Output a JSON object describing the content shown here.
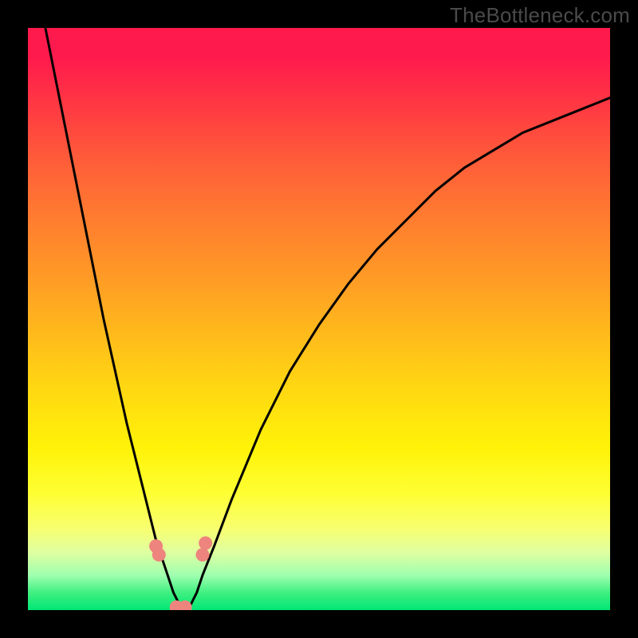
{
  "watermark": "TheBottleneck.com",
  "colors": {
    "frame": "#000000",
    "watermark": "#4a4a4a",
    "curve": "#000000",
    "markers": "#ee847e",
    "gradient_stops": [
      {
        "pos": 0,
        "color": "#ff1a4d"
      },
      {
        "pos": 5,
        "color": "#ff1a4d"
      },
      {
        "pos": 12,
        "color": "#ff3344"
      },
      {
        "pos": 22,
        "color": "#ff5a3a"
      },
      {
        "pos": 32,
        "color": "#ff7a30"
      },
      {
        "pos": 42,
        "color": "#ff9826"
      },
      {
        "pos": 52,
        "color": "#ffb81c"
      },
      {
        "pos": 62,
        "color": "#ffd812"
      },
      {
        "pos": 72,
        "color": "#fff208"
      },
      {
        "pos": 80,
        "color": "#feff33"
      },
      {
        "pos": 86,
        "color": "#f8ff70"
      },
      {
        "pos": 90,
        "color": "#e0ffa0"
      },
      {
        "pos": 94,
        "color": "#a0ffb0"
      },
      {
        "pos": 97,
        "color": "#40f080"
      },
      {
        "pos": 100,
        "color": "#00e676"
      }
    ]
  },
  "chart_data": {
    "type": "line",
    "title": "",
    "xlabel": "",
    "ylabel": "",
    "xlim": [
      0,
      100
    ],
    "ylim": [
      0,
      100
    ],
    "note": "Values are percentages; y=0 is bottom (green), y=100 is top (red). Single V-shaped curve with minimum near x≈25.",
    "series": [
      {
        "name": "bottleneck-curve",
        "x": [
          3,
          5,
          7,
          9,
          11,
          13,
          15,
          17,
          19,
          21,
          22,
          23,
          24,
          25,
          26,
          27,
          28,
          29,
          30,
          32,
          35,
          40,
          45,
          50,
          55,
          60,
          65,
          70,
          75,
          80,
          85,
          90,
          95,
          100
        ],
        "y": [
          100,
          90,
          80,
          70,
          60,
          50,
          41,
          32,
          24,
          16,
          12,
          9,
          6,
          3,
          1,
          0,
          1,
          3,
          6,
          11,
          19,
          31,
          41,
          49,
          56,
          62,
          67,
          72,
          76,
          79,
          82,
          84,
          86,
          88
        ]
      }
    ],
    "markers": [
      {
        "x": 22.0,
        "y": 11.0,
        "label": "left-upper"
      },
      {
        "x": 22.5,
        "y": 9.5,
        "label": "left-lower"
      },
      {
        "x": 25.5,
        "y": 0.5,
        "label": "min-left"
      },
      {
        "x": 27.0,
        "y": 0.5,
        "label": "min-right"
      },
      {
        "x": 30.0,
        "y": 9.5,
        "label": "right-lower"
      },
      {
        "x": 30.5,
        "y": 11.5,
        "label": "right-upper"
      }
    ]
  }
}
